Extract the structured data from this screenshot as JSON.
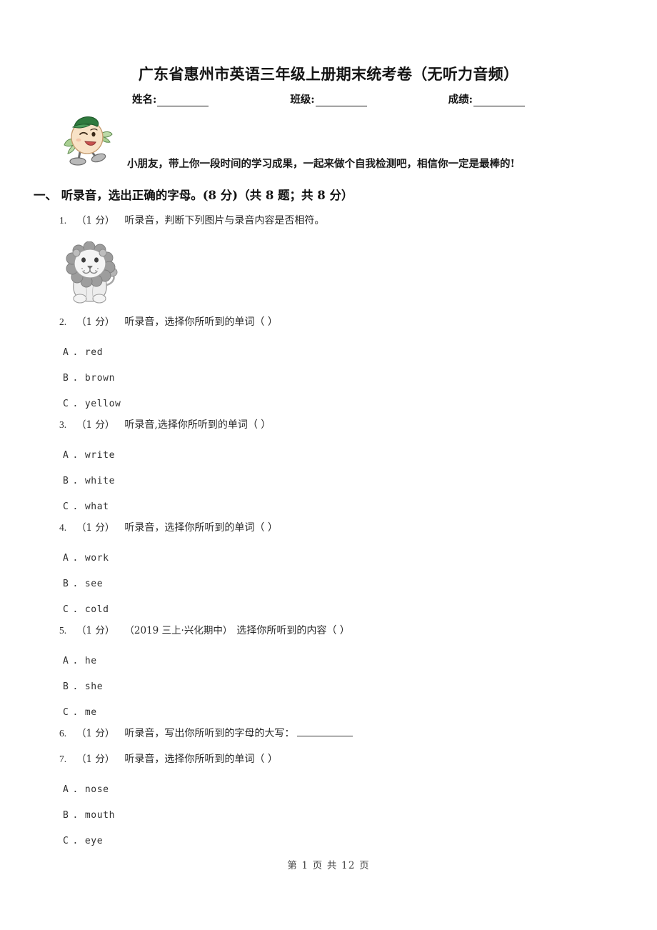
{
  "header": {
    "title": "广东省惠州市英语三年级上册期末统考卷（无听力音频）",
    "fields": [
      {
        "label": "姓名:",
        "value": ""
      },
      {
        "label": "班级:",
        "value": ""
      },
      {
        "label": "成绩:",
        "value": ""
      }
    ],
    "mascot_icon": "cartoon-student-mascot-icon",
    "greeting": "小朋友，带上你一段时间的学习成果，一起来做个自我检测吧，相信你一定是最棒的!"
  },
  "sections": [
    {
      "heading": "一、 听录音，选出正确的字母。(8 分)（共 8 题；共 8 分）"
    }
  ],
  "questions": [
    {
      "num": "1.",
      "score": "（1 分）",
      "tag": "",
      "text": "听录音，判断下列图片与录音内容是否相符。",
      "blank": false,
      "figure": "lion-illustration",
      "options": []
    },
    {
      "num": "2.",
      "score": "（1 分）",
      "tag": "",
      "text": "听录音，选择你所听到的单词（      ）",
      "blank": false,
      "figure": "",
      "options": [
        {
          "key": "A",
          "dot": ".",
          "text": "red"
        },
        {
          "key": "B",
          "dot": ".",
          "text": "brown"
        },
        {
          "key": "C",
          "dot": ".",
          "text": "yellow"
        }
      ]
    },
    {
      "num": "3.",
      "score": "（1 分）",
      "tag": "",
      "text": "听录音,选择你所听到的单词（      ）",
      "blank": false,
      "figure": "",
      "options": [
        {
          "key": "A",
          "dot": ".",
          "text": "write"
        },
        {
          "key": "B",
          "dot": ".",
          "text": "white"
        },
        {
          "key": "C",
          "dot": ".",
          "text": "what"
        }
      ]
    },
    {
      "num": "4.",
      "score": "（1 分）",
      "tag": "",
      "text": "听录音，选择你所听到的单词（      ）",
      "blank": false,
      "figure": "",
      "options": [
        {
          "key": "A",
          "dot": ".",
          "text": "work"
        },
        {
          "key": "B",
          "dot": ".",
          "text": "see"
        },
        {
          "key": "C",
          "dot": ".",
          "text": "cold"
        }
      ]
    },
    {
      "num": "5.",
      "score": "（1 分）",
      "tag": "（2019 三上·兴化期中）",
      "text": "选择你所听到的内容（      ）",
      "blank": false,
      "figure": "",
      "options": [
        {
          "key": "A",
          "dot": ".",
          "text": "he"
        },
        {
          "key": "B",
          "dot": ".",
          "text": "she"
        },
        {
          "key": "C",
          "dot": ".",
          "text": "me"
        }
      ]
    },
    {
      "num": "6.",
      "score": "（1 分）",
      "tag": "",
      "text": "听录音，写出你所听到的字母的大写：",
      "blank": true,
      "figure": "",
      "options": []
    },
    {
      "num": "7.",
      "score": "（1 分）",
      "tag": "",
      "text": "听录音，选择你所听到的单词（      ）",
      "blank": false,
      "figure": "",
      "options": [
        {
          "key": "A",
          "dot": ".",
          "text": "nose"
        },
        {
          "key": "B",
          "dot": ".",
          "text": "mouth"
        },
        {
          "key": "C",
          "dot": ".",
          "text": "eye"
        }
      ]
    }
  ],
  "footer": {
    "page_text": "第 1 页 共 12 页"
  },
  "colors": {
    "page_background": "#ffffff",
    "text": "#2b2b2b",
    "heading": "#111111",
    "mascot_body": "#f6ddc0",
    "mascot_cap": "#2f7a3e",
    "mascot_limb": "#8fbf7a",
    "lion_mane": "#9a9a9a",
    "lion_body": "#e3e3e3"
  }
}
